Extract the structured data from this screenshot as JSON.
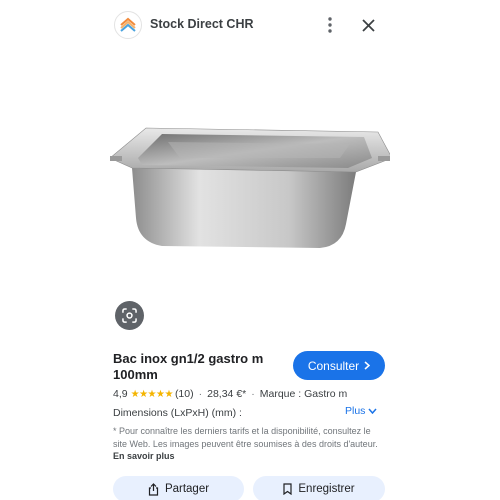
{
  "header": {
    "site_name": "Stock Direct CHR",
    "logo_icon": "stock-direct-chr-logo",
    "more_icon": "more-vert-icon",
    "close_icon": "close-icon"
  },
  "image": {
    "description_icon": "stainless-gastronorm-pan",
    "lens_icon": "google-lens-icon"
  },
  "product": {
    "title": "Bac inox gn1/2 gastro m 100mm",
    "rating": "4,9",
    "stars": "★★★★★",
    "reviews": "(10)",
    "price": "28,34 €*",
    "brand": "Marque : Gastro m",
    "dimensions_label": "Dimensions (LxPxH) (mm) :"
  },
  "actions": {
    "consult_label": "Consulter",
    "more_label": "Plus",
    "share_label": "Partager",
    "save_label": "Enregistrer"
  },
  "disclaimer": {
    "text": "* Pour connaître les derniers tarifs et la disponibilité, consultez le site Web. Les images peuvent être soumises à des droits d'auteur.",
    "link": "En savoir plus"
  },
  "colors": {
    "accent": "#1a73e8",
    "star": "#f4b400",
    "button_bg": "#e8f0fe"
  }
}
